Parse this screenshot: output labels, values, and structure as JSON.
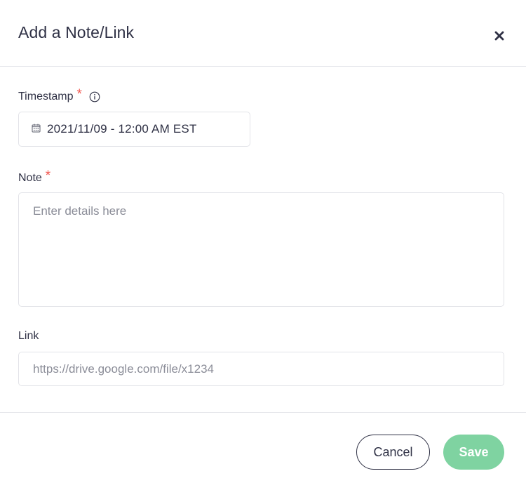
{
  "modal": {
    "title": "Add a Note/Link",
    "close_icon": "close-icon"
  },
  "form": {
    "timestamp": {
      "label": "Timestamp",
      "required_mark": "*",
      "info_icon": "info-icon",
      "calendar_icon": "calendar-icon",
      "value": "2021/11/09 - 12:00 AM EST"
    },
    "note": {
      "label": "Note",
      "required_mark": "*",
      "value": "",
      "placeholder": "Enter details here"
    },
    "link": {
      "label": "Link",
      "value": "",
      "placeholder": "https://drive.google.com/file/x1234"
    }
  },
  "footer": {
    "cancel_label": "Cancel",
    "save_label": "Save"
  },
  "colors": {
    "text": "#2f3145",
    "required": "#f1574f",
    "border": "#e2e3e8",
    "placeholder": "#8b8d98",
    "save_button": "#7fd3a1"
  }
}
